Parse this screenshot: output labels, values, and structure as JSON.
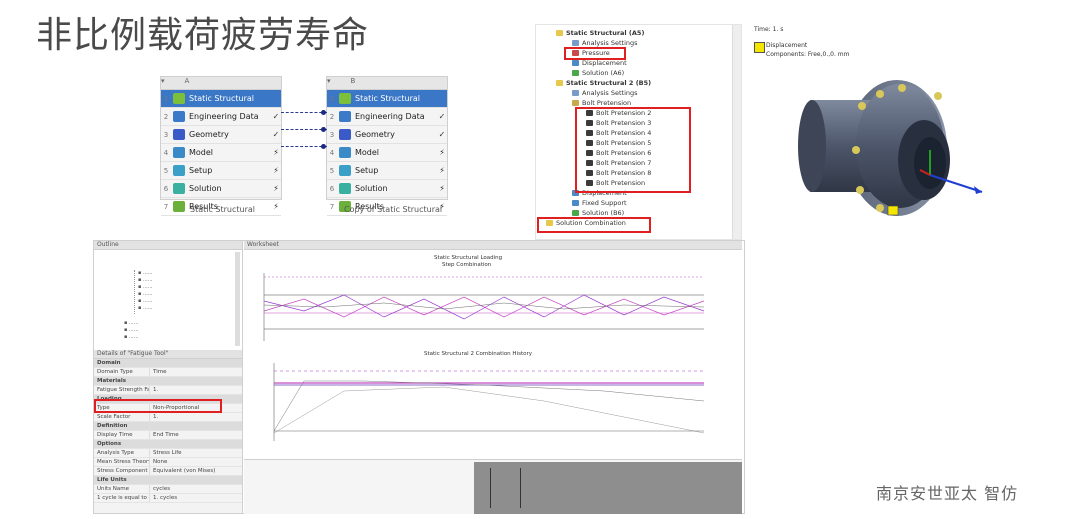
{
  "title": "非比例载荷疲劳寿命",
  "schematic": {
    "system_a": {
      "caption": "Static Structural",
      "rows": [
        {
          "num": "1",
          "label": "Static Structural",
          "status": ""
        },
        {
          "num": "2",
          "label": "Engineering Data",
          "status": "✓"
        },
        {
          "num": "3",
          "label": "Geometry",
          "status": "✓"
        },
        {
          "num": "4",
          "label": "Model",
          "status": "⚡"
        },
        {
          "num": "5",
          "label": "Setup",
          "status": "⚡"
        },
        {
          "num": "6",
          "label": "Solution",
          "status": "⚡"
        },
        {
          "num": "7",
          "label": "Results",
          "status": "⚡"
        }
      ]
    },
    "system_b": {
      "caption": "Copy of Static Structural",
      "rows": [
        {
          "num": "1",
          "label": "Static Structural",
          "status": ""
        },
        {
          "num": "2",
          "label": "Engineering Data",
          "status": "✓"
        },
        {
          "num": "3",
          "label": "Geometry",
          "status": "✓"
        },
        {
          "num": "4",
          "label": "Model",
          "status": "⚡"
        },
        {
          "num": "5",
          "label": "Setup",
          "status": "⚡"
        },
        {
          "num": "6",
          "label": "Solution",
          "status": "⚡"
        },
        {
          "num": "7",
          "label": "Results",
          "status": "⚡"
        }
      ]
    }
  },
  "tree": {
    "nodes": [
      {
        "label": "Static Structural (A5)",
        "bold": true,
        "color": "#e8c84a"
      },
      {
        "label": "Analysis Settings",
        "bold": false,
        "color": "#7a9ac8"
      },
      {
        "label": "Pressure",
        "bold": false,
        "color": "#c84a4a"
      },
      {
        "label": "Displacement",
        "bold": false,
        "color": "#4a8ac8"
      },
      {
        "label": "Solution (A6)",
        "bold": false,
        "color": "#4aa84a"
      },
      {
        "label": "Static Structural 2 (B5)",
        "bold": true,
        "color": "#e8c84a"
      },
      {
        "label": "Analysis Settings",
        "bold": false,
        "color": "#7a9ac8"
      },
      {
        "label": "Bolt Pretension",
        "bold": false,
        "color": "#c8a84a"
      },
      {
        "label": "Bolt Pretension 2",
        "bold": false,
        "color": "#3a3a3a"
      },
      {
        "label": "Bolt Pretension 3",
        "bold": false,
        "color": "#3a3a3a"
      },
      {
        "label": "Bolt Pretension 4",
        "bold": false,
        "color": "#3a3a3a"
      },
      {
        "label": "Bolt Pretension 5",
        "bold": false,
        "color": "#3a3a3a"
      },
      {
        "label": "Bolt Pretension 6",
        "bold": false,
        "color": "#3a3a3a"
      },
      {
        "label": "Bolt Pretension 7",
        "bold": false,
        "color": "#3a3a3a"
      },
      {
        "label": "Bolt Pretension 8",
        "bold": false,
        "color": "#3a3a3a"
      },
      {
        "label": "Bolt Pretension",
        "bold": false,
        "color": "#3a3a3a"
      },
      {
        "label": "Displacement",
        "bold": false,
        "color": "#4a8ac8"
      },
      {
        "label": "Fixed Support",
        "bold": false,
        "color": "#4a8ac8"
      },
      {
        "label": "Solution (B6)",
        "bold": false,
        "color": "#4aa84a"
      },
      {
        "label": "Solution Combination",
        "bold": false,
        "color": "#e8c84a"
      }
    ]
  },
  "view3d": {
    "time_label": "Time: 1. s",
    "legend_name": "Displacement",
    "legend_component": "Components: Free,0.,0. mm"
  },
  "fatigue_app": {
    "outline_header": "Outline",
    "details_header": "Details of \"Fatigue Tool\"",
    "chart_header": "Worksheet",
    "chart1_title": "Static Structural Loading",
    "chart1_subtitle": "Step Combination",
    "chart2_title": "Static Structural 2 Combination History",
    "details": [
      {
        "k": "Domain",
        "v": "",
        "sec": true
      },
      {
        "k": "Domain Type",
        "v": "Time",
        "sec": false
      },
      {
        "k": "Materials",
        "v": "",
        "sec": true
      },
      {
        "k": "Fatigue Strength Factor",
        "v": "1.",
        "sec": false
      },
      {
        "k": "Loading",
        "v": "",
        "sec": true
      },
      {
        "k": "Type",
        "v": "Non-Proportional",
        "sec": false
      },
      {
        "k": "Scale Factor",
        "v": "1.",
        "sec": false
      },
      {
        "k": "Definition",
        "v": "",
        "sec": true
      },
      {
        "k": "Display Time",
        "v": "End Time",
        "sec": false
      },
      {
        "k": "Options",
        "v": "",
        "sec": true
      },
      {
        "k": "Analysis Type",
        "v": "Stress Life",
        "sec": false
      },
      {
        "k": "Mean Stress Theory",
        "v": "None",
        "sec": false
      },
      {
        "k": "Stress Component",
        "v": "Equivalent (von Mises)",
        "sec": false
      },
      {
        "k": "Life Units",
        "v": "",
        "sec": true
      },
      {
        "k": "Units Name",
        "v": "cycles",
        "sec": false
      },
      {
        "k": "1 cycle is equal to",
        "v": "1. cycles",
        "sec": false
      }
    ]
  },
  "watermark": "南京安世亚太 智仿"
}
